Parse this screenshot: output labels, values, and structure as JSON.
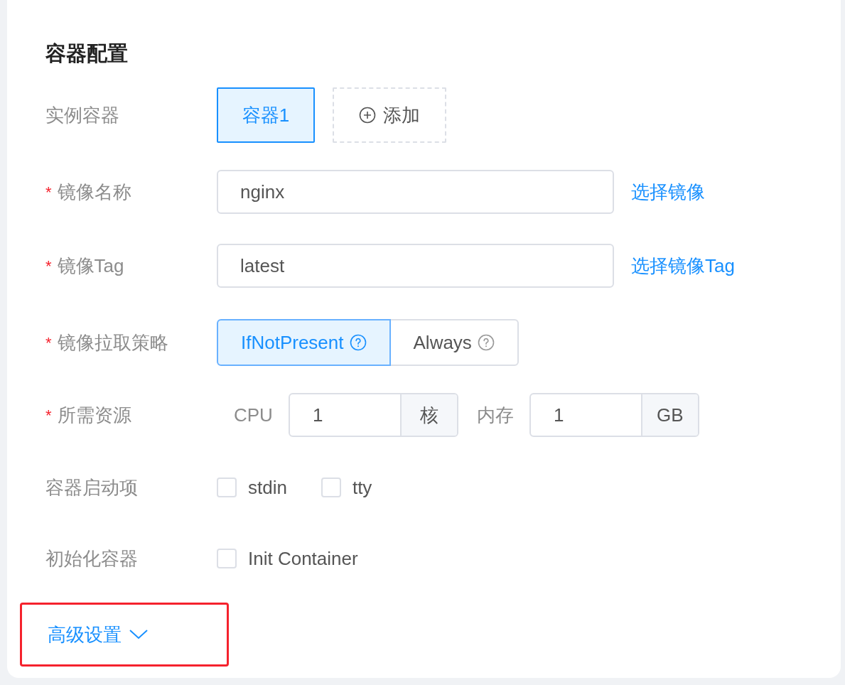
{
  "title": "容器配置",
  "containers": {
    "label": "实例容器",
    "tabs": [
      {
        "label": "容器1",
        "selected": true
      }
    ],
    "add_button": "添加"
  },
  "fields": [
    {
      "kind": "input",
      "label": "镜像名称",
      "required_mark": "*",
      "value": "nginx",
      "link": "选择镜像"
    },
    {
      "kind": "input",
      "label": "镜像Tag",
      "required_mark": "*",
      "value": "latest",
      "link": "选择镜像Tag"
    },
    {
      "kind": "radio",
      "label": "镜像拉取策略",
      "required_mark": "*",
      "options": [
        {
          "label": "IfNotPresent",
          "selected": true
        },
        {
          "label": "Always",
          "selected": false
        }
      ]
    },
    {
      "kind": "resources",
      "label": "所需资源",
      "required_mark": "*",
      "items": [
        {
          "label": "CPU",
          "value": "1",
          "unit": "核"
        },
        {
          "label": "内存",
          "value": "1",
          "unit": "GB"
        }
      ]
    },
    {
      "kind": "checkboxes",
      "label": "容器启动项",
      "options": [
        {
          "label": "stdin",
          "checked": false
        },
        {
          "label": "tty",
          "checked": false
        }
      ]
    },
    {
      "kind": "checkboxes",
      "label": "初始化容器",
      "options": [
        {
          "label": "Init Container",
          "checked": false
        }
      ]
    }
  ],
  "advanced": {
    "label": "高级设置",
    "expanded": false,
    "highlighted": true
  }
}
